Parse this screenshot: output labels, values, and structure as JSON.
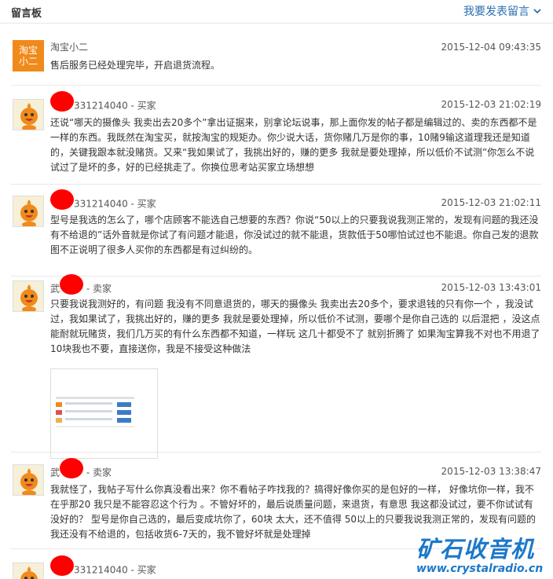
{
  "header": {
    "title": "留言板",
    "post_link": "我要发表留言"
  },
  "messages": [
    {
      "name": "淘宝小二",
      "role": "",
      "time": "2015-12-04 09:43:35",
      "avatar": "shop-logo",
      "avatar_text": "淘宝\n小二",
      "content": "售后服务已经处理完毕，开启退货流程。"
    },
    {
      "name_suffix": "331214040 - 买家",
      "time": "2015-12-03 21:02:19",
      "avatar": "buyer-mascot",
      "content": "还说“哪天的摄像头 我卖出去20多个”拿出证据来，别拿论坛说事，那上面你发的帖子都是编辑过的、卖的东西都不是一样的东西。我既然在淘宝买，就按淘宝的规矩办。你少说大话，货你赌几万是你的事，10赌9输这道理我还是知道的，关键我跟本就没赌货。又来“我如果试了，我挑出好的，赚的更多 我就是要处理掉，所以低价不试测”你怎么不说试过了是坏的多，好的已经挑走了。你换位思考站买家立场想想"
    },
    {
      "name_suffix": "331214040 - 买家",
      "time": "2015-12-03 21:02:11",
      "avatar": "buyer-mascot",
      "content": "型号是我选的怎么了，哪个店顾客不能选自己想要的东西？你说“50以上的只要我说我测正常的，发现有问题的我还没有不给退的”话外音就是你试了有问题才能退，你没试过的就不能退，货款低于50哪怕试过也不能退。你自己发的退款图不正说明了很多人买你的东西都是有过纠纷的。"
    },
    {
      "name_prefix": "武",
      "name_suffix": "- 卖家",
      "time": "2015-12-03 13:43:01",
      "avatar": "buyer-mascot",
      "content": "只要我说我测好的，有问题 我没有不同意退货的，哪天的摄像头 我卖出去20多个，要求退钱的只有你一个 ，我没试过，我如果试了，我挑出好的，赚的更多 我就是要处理掉，所以低价不试测，要哪个是你自己选的 以后混把 ，没这点能耐就玩赌货，我们几万买的有什么东西都不知道，一样玩 这几十都受不了 就别折腾了 如果淘宝算我不对也不用退了 10块我也不要，直接送你，我是不接受这种做法"
    },
    {
      "name_prefix": "武",
      "name_suffix": "- 卖家",
      "time": "2015-12-03 13:38:47",
      "avatar": "buyer-mascot",
      "content": "我就怪了，我帖子写什么你真没看出来？你不看帖子咋找我的？搞得好像你买的是包好的一样， 好像坑你一样，我不在乎那20 我只是不能容忍这个行为 。不管好坏的，最后说质量问题，来退货，有意思 我这都没试过，要不你试试有没好的？ 型号是你自己选的，最后变成坑你了，60块 太大，还不值得 50以上的只要我说我测正常的，发现有问题的我还没有不给退的，包括收货6-7天的，我不管好坏就是处理掉"
    },
    {
      "name_suffix": "331214040 - 买家",
      "time": "",
      "avatar": "buyer-mascot",
      "content": ""
    }
  ],
  "watermark": {
    "text": "矿石收音机",
    "url": "www.crystalradio.cn"
  },
  "colors": {
    "link": "#2a6fb0",
    "redaction": "#ff0000",
    "watermark": "#1b78c9",
    "shop_orange": "#f08a1a"
  }
}
